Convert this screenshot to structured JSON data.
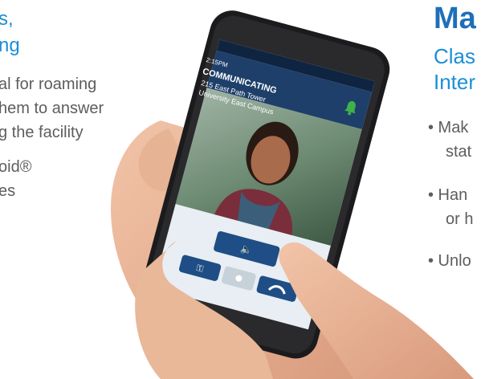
{
  "left": {
    "heading_line1": "s,",
    "heading_line2": "ng",
    "body_line1": "al for roaming",
    "body_line2": "hem to answer",
    "body_line3": "g the facility",
    "body_line4": "oid®",
    "body_line5": "es"
  },
  "right": {
    "title": "Ma",
    "subtitle_line1": "Clas",
    "subtitle_line2": "Inter",
    "bullet1_line1": "• Mak",
    "bullet1_line2": "stat",
    "bullet2_line1": "• Han",
    "bullet2_line2": "or h",
    "bullet3_line1": "• Unlo"
  },
  "phone": {
    "status_time": "2:15PM",
    "call_status": "COMMUNICATING",
    "location_line1": "215 East Path Tower",
    "location_line2": "University East Campus"
  },
  "colors": {
    "accent_blue": "#1c8fd6",
    "title_blue": "#1f6fb8",
    "header_navy": "#1e3f6a",
    "bell_green": "#3fb24a",
    "hangup_red": "#c0392b"
  },
  "icons": {
    "bell": "bell-icon",
    "talk": "talk-icon",
    "key": "key-icon",
    "mic": "mic-icon",
    "hangup": "hangup-icon"
  }
}
